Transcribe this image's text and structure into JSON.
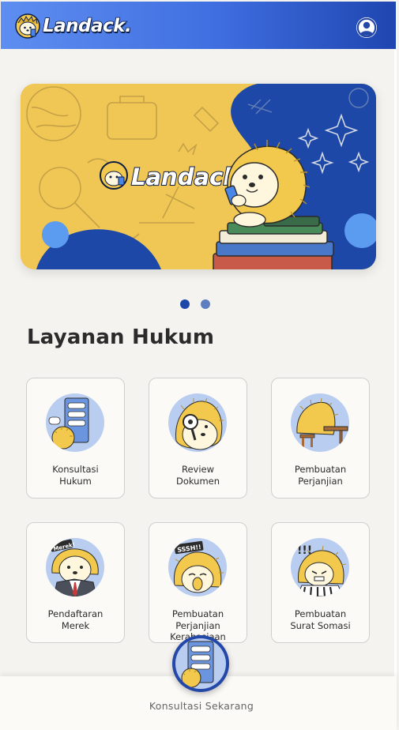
{
  "header": {
    "brand": "Landack.",
    "icons": {
      "profile": "user-circle-icon"
    }
  },
  "banner": {
    "brand": "Landack.",
    "colors": {
      "yellow": "#f0c654",
      "blue": "#1d48a8",
      "accent": "#5b9bf0"
    }
  },
  "carousel": {
    "total_slides": 2,
    "active_index": 0
  },
  "section": {
    "title": "Layanan Hukum"
  },
  "services": [
    {
      "label": "Konsultasi\nHukum",
      "icon": "chat-hedgehog-icon"
    },
    {
      "label": "Review\nDokumen",
      "icon": "magnifier-hedgehog-icon"
    },
    {
      "label": "Pembuatan\nPerjanjian",
      "icon": "desk-hedgehog-icon"
    },
    {
      "label": "Pendaftaran\nMerek",
      "icon": "brand-hedgehog-icon"
    },
    {
      "label": "Pembuatan\nPerjanjian\nKerahasiaan",
      "icon": "secret-hedgehog-icon"
    },
    {
      "label": "Pembuatan\nSurat Somasi",
      "icon": "warning-hedgehog-icon"
    }
  ],
  "cta": {
    "label": "Konsultasi Sekarang",
    "icon": "chat-hedgehog-icon"
  },
  "colors": {
    "header_gradient_start": "#5e8ef0",
    "header_gradient_end": "#1f46b0",
    "card_bg": "#fbfaf7",
    "icon_circle": "#b9cdf0",
    "page_bg": "#f4f3ef"
  }
}
